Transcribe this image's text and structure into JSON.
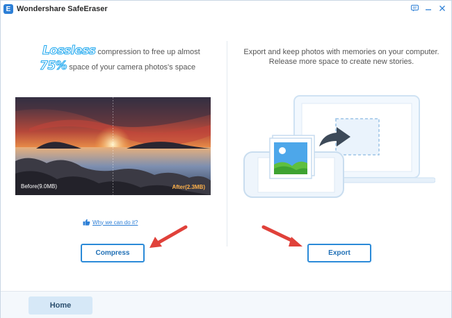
{
  "window": {
    "title": "Wondershare SafeEraser",
    "logo_letter": "E",
    "controls": [
      "feedback-icon",
      "minimize-icon",
      "close-icon"
    ]
  },
  "left": {
    "headline": {
      "word1": "Lossless",
      "text1": "compression to free up almost",
      "word2": "75%",
      "text2": "space of your camera photos's space"
    },
    "photo": {
      "before_label": "Before(9.0MB)",
      "after_label": "After(2.3MB)"
    },
    "why_link": "Why we can do it?",
    "compress_button": "Compress"
  },
  "right": {
    "description": "Export and keep photos with memories on your computer. Release more space to create new stories.",
    "export_button": "Export"
  },
  "footer": {
    "home_tab": "Home"
  },
  "colors": {
    "accent": "#2b8ad8",
    "highlight": "#23a9ef",
    "annotation_arrow": "#e0413a",
    "after_label": "#ffb14a"
  }
}
